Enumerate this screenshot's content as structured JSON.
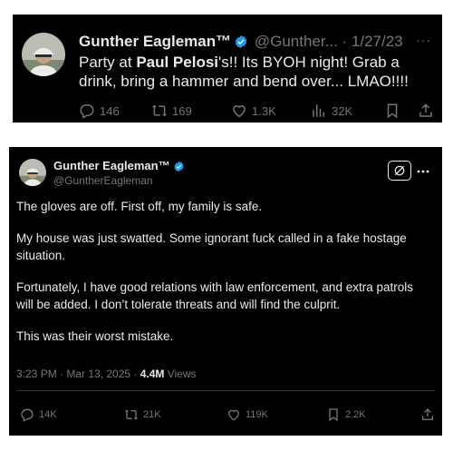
{
  "tweet1": {
    "name": "Gunther Eagleman™",
    "handle": "@Gunther...",
    "date": "· 1/27/23",
    "more": "···",
    "body_part1": "Party at ",
    "body_bold": "Paul Pelosi",
    "body_part2": "'s!!  Its BYOH night!  Grab a drink, bring a hammer and bend over...  LMAO!!!!",
    "replies": "146",
    "retweets": "169",
    "likes": "1.3K",
    "views": "32K"
  },
  "tweet2": {
    "name": "Gunther Eagleman™",
    "handle": "@GuntherEagleman",
    "paragraphs": [
      "The gloves are off. First off, my family is safe.",
      "My house was just swatted. Some ignorant fuck called in a fake hostage situation.",
      "Fortunately, I have good relations with law enforcement, and extra patrols will be added. I don’t tolerate threats and will find the culprit.",
      "This was their worst mistake."
    ],
    "timestamp": "3:23 PM · Mar 13, 2025 · ",
    "views_count": "4.4M",
    "views_label": " Views",
    "replies": "14K",
    "retweets": "21K",
    "likes": "119K",
    "bookmarks": "2.2K"
  },
  "colors": {
    "background": "#000000",
    "text": "#e7e9ea",
    "secondary": "#71767b",
    "verified": "#1d9bf0"
  }
}
